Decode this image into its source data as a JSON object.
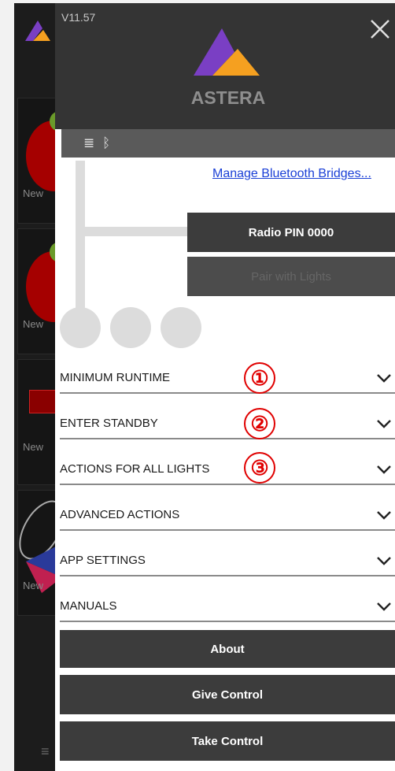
{
  "drawer": {
    "version": "V11.57",
    "logo_text": "ASTERA",
    "manage_link": "Manage Bluetooth Bridges...",
    "radio_pin": "Radio PIN 0000",
    "pair": "Pair with Lights"
  },
  "sections": [
    {
      "label": "MINIMUM RUNTIME",
      "marker": "①"
    },
    {
      "label": "ENTER STANDBY",
      "marker": "②"
    },
    {
      "label": "ACTIONS FOR ALL LIGHTS",
      "marker": "③"
    },
    {
      "label": "ADVANCED ACTIONS"
    },
    {
      "label": "APP SETTINGS"
    },
    {
      "label": "MANUALS"
    }
  ],
  "buttons": {
    "about": "About",
    "give_control": "Give Control",
    "take_control": "Take Control"
  },
  "background_app": {
    "cards": [
      "New",
      "New",
      "New",
      "New"
    ]
  },
  "colors": {
    "header": "#343434",
    "logo_purple": "#7a3fc4",
    "logo_orange": "#f5a020",
    "link": "#1a3fd6",
    "marker_red": "#e00000"
  },
  "icons": [
    "close-icon",
    "light-bulb-icon",
    "bluetooth-off-icon",
    "chevron-down-icon"
  ]
}
